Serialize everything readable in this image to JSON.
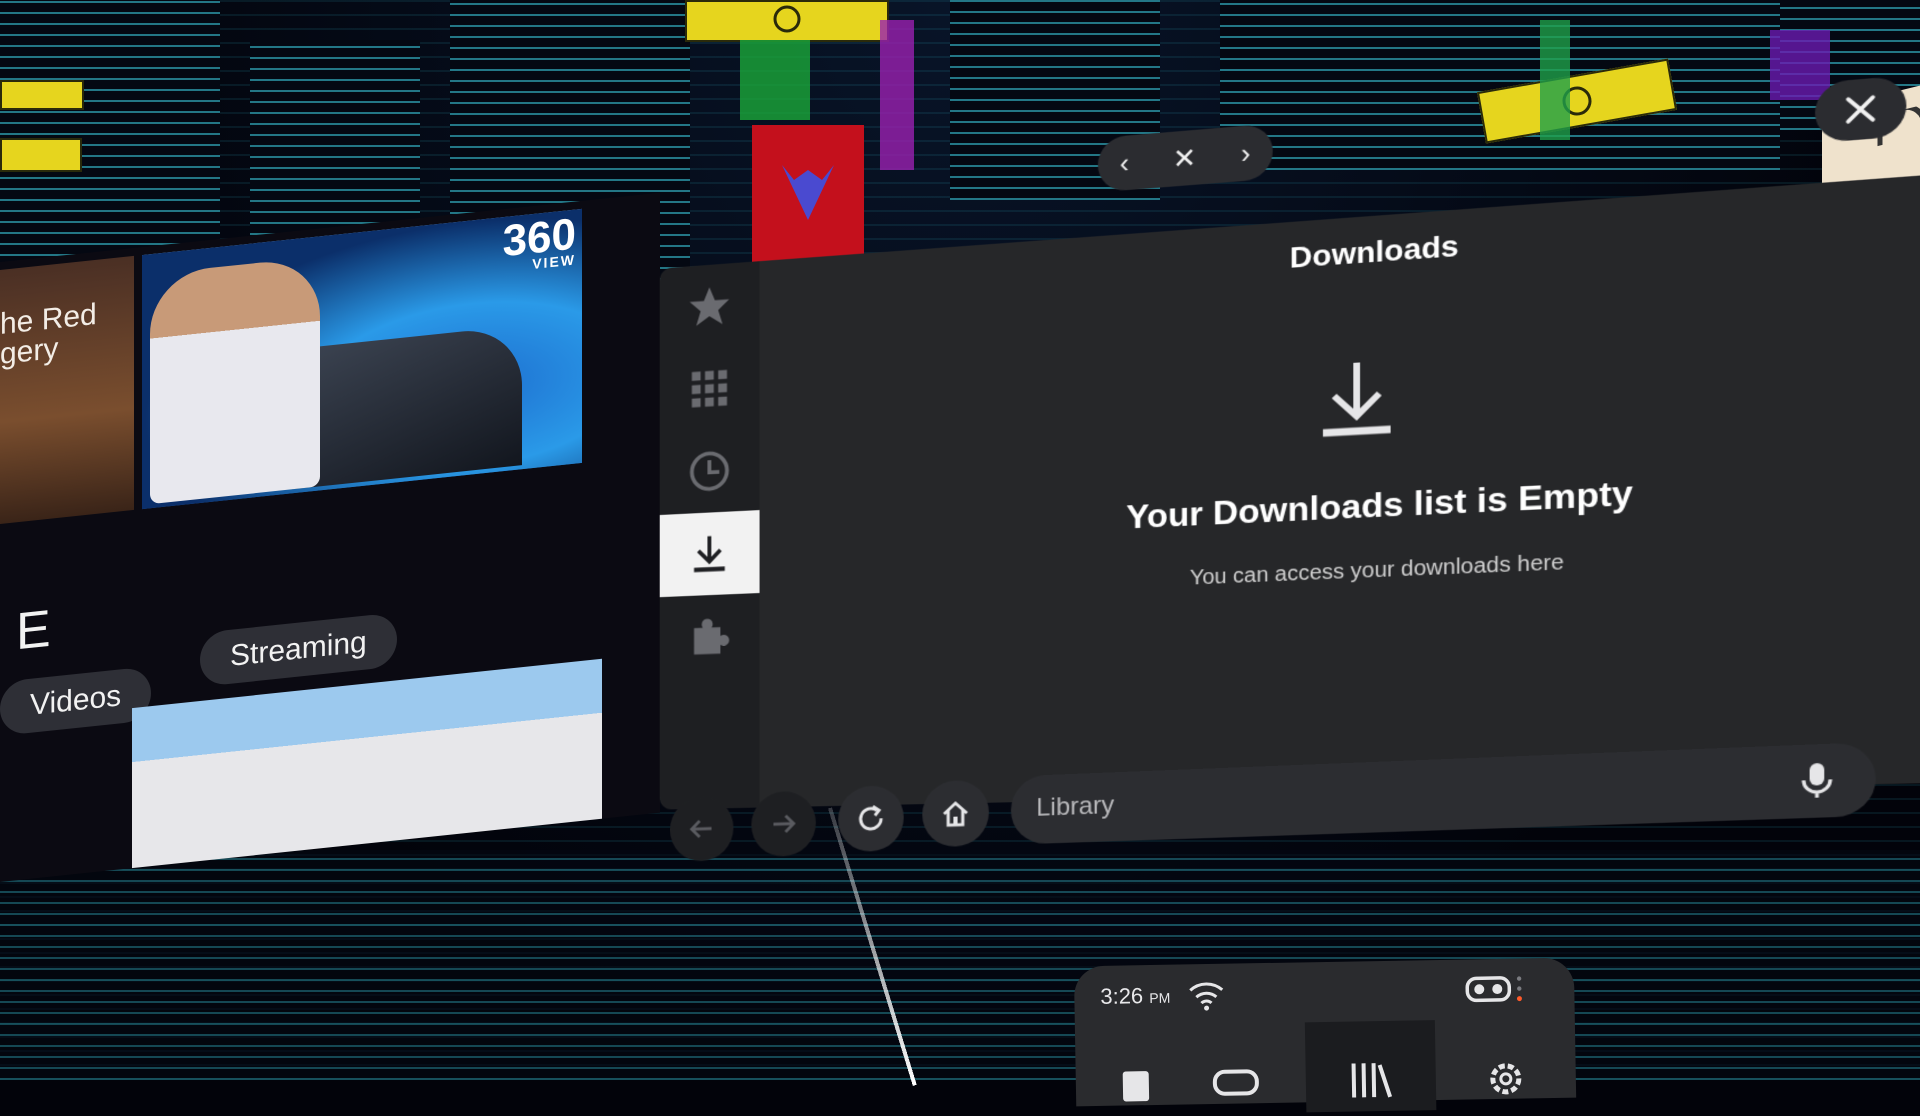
{
  "left_panel": {
    "thumb1_text": "he Red\ngery",
    "badge_360": "360",
    "badge_view": "VIEW",
    "letter": "E",
    "chips": [
      "Videos",
      "Streaming"
    ]
  },
  "window": {
    "title": "Downloads",
    "empty_title": "Your Downloads list is Empty",
    "empty_subtitle": "You can access your downloads here",
    "tab_pill": {
      "prev": "‹",
      "close": "✕",
      "next": "›"
    },
    "close_label": "✕",
    "rail": [
      {
        "name": "bookmarks",
        "icon": "star-icon"
      },
      {
        "name": "apps",
        "icon": "grid-icon"
      },
      {
        "name": "history",
        "icon": "clock-icon"
      },
      {
        "name": "downloads",
        "icon": "download-icon",
        "active": true
      },
      {
        "name": "addons",
        "icon": "puzzle-icon"
      }
    ]
  },
  "toolbar": {
    "address_placeholder": "Library",
    "buttons": [
      "back-icon",
      "forward-icon",
      "refresh-icon",
      "home-icon",
      "mic-icon",
      "help-icon"
    ]
  },
  "tray": {
    "time": "3:26",
    "ampm": "PM",
    "icons": [
      "wifi-icon",
      "vr-headset-icon",
      "profile-tab-icon",
      "mask-tab-icon",
      "library-tab-icon",
      "settings-tab-icon"
    ]
  },
  "colors": {
    "panel_bg": "#262729",
    "rail_bg": "#1e1f22",
    "rail_active": "#f2f2f2",
    "accent_neon": "#32d2e6",
    "sign_yellow": "#e6d51e",
    "banner_red": "#c4101c"
  }
}
